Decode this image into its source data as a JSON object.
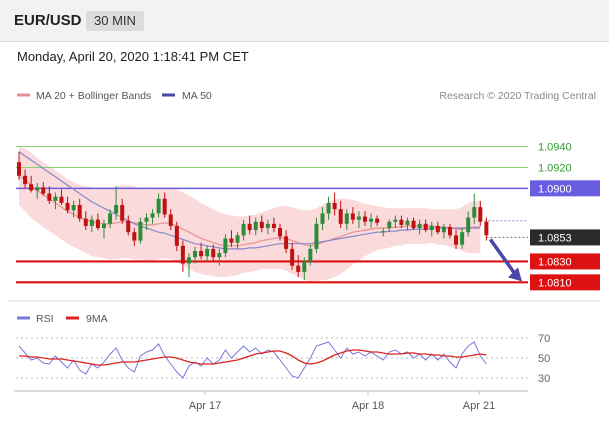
{
  "header": {
    "pair": "EUR/USD",
    "timeframe": "30 MIN"
  },
  "datetime": "Monday, April 20, 2020 1:18:41 PM CET",
  "legend": {
    "ma20": "MA 20 + Bollinger Bands",
    "ma50": "MA 50",
    "credit": "Research © 2020 Trading Central"
  },
  "colors": {
    "bull": "#2e8b3a",
    "bear": "#c01010",
    "ma20": "#e89090",
    "band": "#f9d4d4",
    "ma50": "#8888cc",
    "resistance": "#6a5ce0",
    "resistance_minor": "#88d070",
    "support": "#dd1111",
    "arrow": "#4a46a8",
    "rsi": "#7777dd",
    "rsi_ma": "#dd2222"
  },
  "chart_data": {
    "type": "candlestick",
    "ylim": [
      1.0795,
      1.0975
    ],
    "x_ticks": [
      "Apr 17",
      "Apr 18",
      "Apr 21"
    ],
    "current_price": {
      "value": 1.0853,
      "label": "1.0853"
    },
    "levels": [
      {
        "value": 1.094,
        "label": "1.0940",
        "kind": "resistance-minor"
      },
      {
        "value": 1.092,
        "label": "1.0920",
        "kind": "resistance-minor"
      },
      {
        "value": 1.09,
        "label": "1.0900",
        "kind": "resistance"
      },
      {
        "value": 1.083,
        "label": "1.0830",
        "kind": "support"
      },
      {
        "value": 1.081,
        "label": "1.0810",
        "kind": "support"
      }
    ],
    "forecast_target": 1.081,
    "candles": [
      [
        1.0925,
        1.0935,
        1.0908,
        1.0912
      ],
      [
        1.0912,
        1.0918,
        1.09,
        1.0904
      ],
      [
        1.0904,
        1.0912,
        1.0896,
        1.0898
      ],
      [
        1.0898,
        1.0905,
        1.089,
        1.0901
      ],
      [
        1.0901,
        1.0906,
        1.0893,
        1.0895
      ],
      [
        1.0895,
        1.0902,
        1.0885,
        1.0888
      ],
      [
        1.0888,
        1.0896,
        1.088,
        1.0892
      ],
      [
        1.0892,
        1.0899,
        1.0884,
        1.0886
      ],
      [
        1.0886,
        1.0892,
        1.0876,
        1.0879
      ],
      [
        1.0879,
        1.0888,
        1.0872,
        1.0884
      ],
      [
        1.0884,
        1.089,
        1.0868,
        1.0871
      ],
      [
        1.0871,
        1.0878,
        1.086,
        1.0864
      ],
      [
        1.0864,
        1.0874,
        1.0858,
        1.087
      ],
      [
        1.087,
        1.0876,
        1.086,
        1.0862
      ],
      [
        1.0862,
        1.087,
        1.0852,
        1.0866
      ],
      [
        1.0866,
        1.088,
        1.0862,
        1.0876
      ],
      [
        1.0876,
        1.0902,
        1.087,
        1.0884
      ],
      [
        1.0884,
        1.089,
        1.0866,
        1.0869
      ],
      [
        1.0869,
        1.0874,
        1.0855,
        1.0858
      ],
      [
        1.0858,
        1.0862,
        1.0845,
        1.085
      ],
      [
        1.085,
        1.0872,
        1.0847,
        1.0868
      ],
      [
        1.0868,
        1.0876,
        1.086,
        1.0872
      ],
      [
        1.0872,
        1.088,
        1.0866,
        1.0876
      ],
      [
        1.0876,
        1.0895,
        1.0872,
        1.089
      ],
      [
        1.089,
        1.0896,
        1.0872,
        1.0875
      ],
      [
        1.0875,
        1.088,
        1.086,
        1.0864
      ],
      [
        1.0864,
        1.0868,
        1.084,
        1.0845
      ],
      [
        1.0845,
        1.085,
        1.082,
        1.0828
      ],
      [
        1.0828,
        1.0838,
        1.0815,
        1.0834
      ],
      [
        1.0834,
        1.0844,
        1.0828,
        1.084
      ],
      [
        1.084,
        1.0848,
        1.0832,
        1.0835
      ],
      [
        1.0835,
        1.0845,
        1.083,
        1.0842
      ],
      [
        1.0842,
        1.0846,
        1.083,
        1.0834
      ],
      [
        1.0834,
        1.0842,
        1.0826,
        1.0838
      ],
      [
        1.0838,
        1.0856,
        1.0834,
        1.0852
      ],
      [
        1.0852,
        1.086,
        1.0844,
        1.0848
      ],
      [
        1.0848,
        1.0858,
        1.0842,
        1.0855
      ],
      [
        1.0855,
        1.087,
        1.085,
        1.0866
      ],
      [
        1.0866,
        1.0874,
        1.0856,
        1.086
      ],
      [
        1.086,
        1.0872,
        1.0855,
        1.0868
      ],
      [
        1.0868,
        1.0874,
        1.0858,
        1.0862
      ],
      [
        1.0862,
        1.087,
        1.0856,
        1.0866
      ],
      [
        1.0866,
        1.0872,
        1.0858,
        1.0862
      ],
      [
        1.0862,
        1.0866,
        1.085,
        1.0854
      ],
      [
        1.0854,
        1.086,
        1.0838,
        1.0842
      ],
      [
        1.0842,
        1.0848,
        1.0822,
        1.0826
      ],
      [
        1.0826,
        1.0836,
        1.0815,
        1.082
      ],
      [
        1.082,
        1.0834,
        1.0812,
        1.083
      ],
      [
        1.083,
        1.0846,
        1.0826,
        1.0842
      ],
      [
        1.0842,
        1.0872,
        1.0838,
        1.0866
      ],
      [
        1.0866,
        1.0882,
        1.086,
        1.0876
      ],
      [
        1.0876,
        1.0892,
        1.087,
        1.0886
      ],
      [
        1.0886,
        1.0896,
        1.0874,
        1.088
      ],
      [
        1.088,
        1.0888,
        1.0862,
        1.0866
      ],
      [
        1.0866,
        1.088,
        1.086,
        1.0876
      ],
      [
        1.0876,
        1.0882,
        1.0866,
        1.087
      ],
      [
        1.087,
        1.0878,
        1.0862,
        1.0873
      ],
      [
        1.0873,
        1.0878,
        1.0864,
        1.0868
      ],
      [
        1.0868,
        1.0876,
        1.0862,
        1.0871
      ],
      [
        1.0871,
        1.0874,
        1.0864,
        1.0867
      ],
      [
        1.0858,
        1.0862,
        1.0854,
        1.0859
      ],
      [
        1.0862,
        1.087,
        1.0858,
        1.0868
      ],
      [
        1.0868,
        1.0874,
        1.0862,
        1.087
      ],
      [
        1.087,
        1.0874,
        1.0862,
        1.0865
      ],
      [
        1.0865,
        1.0872,
        1.086,
        1.0869
      ],
      [
        1.0869,
        1.0872,
        1.086,
        1.0862
      ],
      [
        1.0862,
        1.087,
        1.0856,
        1.0866
      ],
      [
        1.0866,
        1.087,
        1.0858,
        1.086
      ],
      [
        1.086,
        1.0868,
        1.0854,
        1.0864
      ],
      [
        1.0864,
        1.0868,
        1.0856,
        1.0858
      ],
      [
        1.0858,
        1.0866,
        1.0852,
        1.0863
      ],
      [
        1.0863,
        1.0866,
        1.0852,
        1.0855
      ],
      [
        1.0855,
        1.086,
        1.0842,
        1.0846
      ],
      [
        1.0846,
        1.0862,
        1.0842,
        1.0858
      ],
      [
        1.0858,
        1.0878,
        1.0854,
        1.0872
      ],
      [
        1.0872,
        1.0895,
        1.0866,
        1.0882
      ],
      [
        1.0882,
        1.0888,
        1.0864,
        1.0868
      ],
      [
        1.0868,
        1.0872,
        1.085,
        1.0855
      ]
    ],
    "ma20": [
      1.0912,
      1.0908,
      1.0903,
      1.0898,
      1.0894,
      1.089,
      1.0886,
      1.0882,
      1.0878,
      1.0875,
      1.0872,
      1.087,
      1.0868,
      1.0867,
      1.0866,
      1.0866,
      1.0867,
      1.0868,
      1.0868,
      1.0867,
      1.0866,
      1.0865,
      1.0865,
      1.0866,
      1.0867,
      1.0866,
      1.0864,
      1.0861,
      1.0858,
      1.0855,
      1.0852,
      1.085,
      1.0848,
      1.0846,
      1.0845,
      1.0845,
      1.0845,
      1.0846,
      1.0847,
      1.0848,
      1.085,
      1.0851,
      1.0852,
      1.0853,
      1.0852,
      1.085,
      1.0848,
      1.0846,
      1.0845,
      1.0846,
      1.0848,
      1.085,
      1.0852,
      1.0854,
      1.0856,
      1.0858,
      1.0859,
      1.086,
      1.0861,
      1.0862,
      1.0862,
      1.0862,
      1.0863,
      1.0863,
      1.0864,
      1.0864,
      1.0864,
      1.0864,
      1.0864,
      1.0863,
      1.0863,
      1.0862,
      1.0861,
      1.0861,
      1.0862,
      1.0863,
      1.0863
    ],
    "ma50": [
      1.0935,
      1.0931,
      1.0927,
      1.0923,
      1.0919,
      1.0915,
      1.0911,
      1.0907,
      1.0903,
      1.0899,
      1.0895,
      1.0891,
      1.0887,
      1.0884,
      1.0881,
      1.0878,
      1.0875,
      1.0872,
      1.0869,
      1.0866,
      1.0864,
      1.0862,
      1.086,
      1.0858,
      1.0857,
      1.0855,
      1.0853,
      1.0851,
      1.0849,
      1.0847,
      1.0846,
      1.0845,
      1.0844,
      1.0843,
      1.0842,
      1.0842,
      1.0842,
      1.0842,
      1.0843,
      1.0843,
      1.0844,
      1.0845,
      1.0846,
      1.0847,
      1.0847,
      1.0847,
      1.0847,
      1.0847,
      1.0847,
      1.0848,
      1.0849,
      1.085,
      1.0851,
      1.0852,
      1.0853,
      1.0854,
      1.0855,
      1.0856,
      1.0857,
      1.0858,
      1.0858,
      1.0859,
      1.0859,
      1.086,
      1.086,
      1.0861,
      1.0861,
      1.0861,
      1.0862,
      1.0862,
      1.0862,
      1.0862,
      1.0862,
      1.0862,
      1.0862,
      1.0862,
      1.0862
    ],
    "bollinger_upper": [
      1.094,
      1.0938,
      1.0934,
      1.0929,
      1.0925,
      1.0921,
      1.0917,
      1.0913,
      1.0909,
      1.0906,
      1.0903,
      1.0902,
      1.0901,
      1.09,
      1.0899,
      1.09,
      1.0902,
      1.0903,
      1.0903,
      1.0902,
      1.09,
      1.0899,
      1.0899,
      1.09,
      1.0901,
      1.09,
      1.0899,
      1.0896,
      1.0893,
      1.089,
      1.0886,
      1.0883,
      1.088,
      1.0877,
      1.0875,
      1.0874,
      1.0873,
      1.0873,
      1.0874,
      1.0875,
      1.0877,
      1.0879,
      1.0881,
      1.0883,
      1.0883,
      1.0882,
      1.088,
      1.0879,
      1.0879,
      1.0881,
      1.0884,
      1.0887,
      1.0889,
      1.089,
      1.089,
      1.0889,
      1.0887,
      1.0885,
      1.0884,
      1.0883,
      1.0882,
      1.0881,
      1.0881,
      1.0881,
      1.0881,
      1.0881,
      1.0881,
      1.0881,
      1.088,
      1.088,
      1.088,
      1.088,
      1.088,
      1.0882,
      1.0886,
      1.0888,
      1.0888
    ],
    "bollinger_lower": [
      1.0884,
      1.0878,
      1.0872,
      1.0867,
      1.0863,
      1.0859,
      1.0855,
      1.0851,
      1.0847,
      1.0844,
      1.0841,
      1.0838,
      1.0835,
      1.0834,
      1.0833,
      1.0832,
      1.0832,
      1.0833,
      1.0833,
      1.0832,
      1.0832,
      1.0831,
      1.0831,
      1.0832,
      1.0833,
      1.0832,
      1.0829,
      1.0826,
      1.0823,
      1.082,
      1.0818,
      1.0817,
      1.0816,
      1.0815,
      1.0815,
      1.0816,
      1.0817,
      1.0819,
      1.082,
      1.0821,
      1.0823,
      1.0823,
      1.0823,
      1.0823,
      1.0821,
      1.0818,
      1.0816,
      1.0813,
      1.0811,
      1.0811,
      1.0812,
      1.0813,
      1.0815,
      1.0818,
      1.0822,
      1.0827,
      1.0831,
      1.0835,
      1.0838,
      1.0841,
      1.0842,
      1.0843,
      1.0845,
      1.0845,
      1.0847,
      1.0847,
      1.0847,
      1.0847,
      1.0848,
      1.0846,
      1.0846,
      1.0844,
      1.0842,
      1.084,
      1.0838,
      1.0838,
      1.0838
    ]
  },
  "rsi": {
    "legend": {
      "rsi": "RSI",
      "ma": "9MA"
    },
    "ticks": [
      {
        "value": 70,
        "label": "70"
      },
      {
        "value": 50,
        "label": "50"
      },
      {
        "value": 30,
        "label": "30"
      }
    ],
    "ylim": [
      20,
      78
    ],
    "rsi_values": [
      62,
      55,
      48,
      50,
      45,
      44,
      52,
      46,
      40,
      48,
      38,
      34,
      44,
      40,
      46,
      54,
      60,
      48,
      40,
      36,
      52,
      56,
      58,
      64,
      52,
      44,
      36,
      30,
      42,
      46,
      42,
      50,
      44,
      48,
      58,
      50,
      56,
      62,
      56,
      60,
      54,
      58,
      56,
      48,
      40,
      32,
      30,
      40,
      50,
      62,
      64,
      66,
      58,
      50,
      60,
      54,
      56,
      52,
      56,
      52,
      48,
      56,
      58,
      54,
      56,
      50,
      54,
      48,
      54,
      48,
      54,
      46,
      40,
      54,
      62,
      66,
      52,
      44
    ],
    "ma_values": [
      52,
      52,
      51,
      51,
      50,
      49,
      49,
      49,
      48,
      47,
      46,
      45,
      44,
      43,
      43,
      44,
      45,
      46,
      46,
      46,
      47,
      48,
      49,
      50,
      51,
      51,
      50,
      48,
      46,
      45,
      44,
      44,
      44,
      45,
      46,
      47,
      48,
      50,
      52,
      54,
      55,
      56,
      57,
      57,
      55,
      52,
      48,
      45,
      44,
      45,
      47,
      50,
      53,
      55,
      57,
      58,
      58,
      57,
      56,
      56,
      55,
      54,
      54,
      54,
      55,
      55,
      54,
      54,
      53,
      53,
      52,
      52,
      51,
      51,
      52,
      53,
      54,
      53
    ]
  }
}
